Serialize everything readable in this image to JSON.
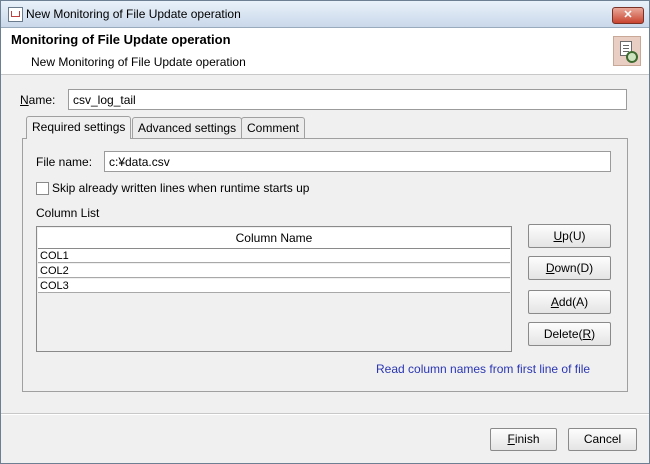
{
  "window": {
    "title": "New Monitoring of File Update operation",
    "close_label": "✕"
  },
  "header": {
    "title": "Monitoring of File Update operation",
    "subtitle": "New Monitoring of File Update operation",
    "icon": "file-monitor-icon"
  },
  "name_field": {
    "label_mnemonic": "N",
    "label_rest": "ame:",
    "value": "csv_log_tail"
  },
  "tabs": [
    {
      "label": "Required settings",
      "active": true
    },
    {
      "label": "Advanced settings",
      "active": false
    },
    {
      "label": "Comment",
      "active": false
    }
  ],
  "required": {
    "file_name_label": "File name:",
    "file_name_value": "c:¥data.csv",
    "skip_checkbox_label": "Skip already written lines when runtime starts up",
    "skip_checked": false,
    "column_list_label": "Column List",
    "column_header": "Column Name",
    "columns": [
      "COL1",
      "COL2",
      "COL3"
    ],
    "read_link": "Read column names from first line of file"
  },
  "side_buttons": {
    "up": {
      "mnemonic": "U",
      "rest": "p(U)"
    },
    "down": {
      "mnemonic": "D",
      "rest": "own(D)"
    },
    "add": {
      "mnemonic": "A",
      "rest": "dd(A)"
    },
    "delete": {
      "text": "Delete(",
      "mnemonic": "R",
      "tail": ")"
    }
  },
  "footer": {
    "finish": {
      "mnemonic": "F",
      "rest": "inish"
    },
    "cancel": "Cancel"
  }
}
